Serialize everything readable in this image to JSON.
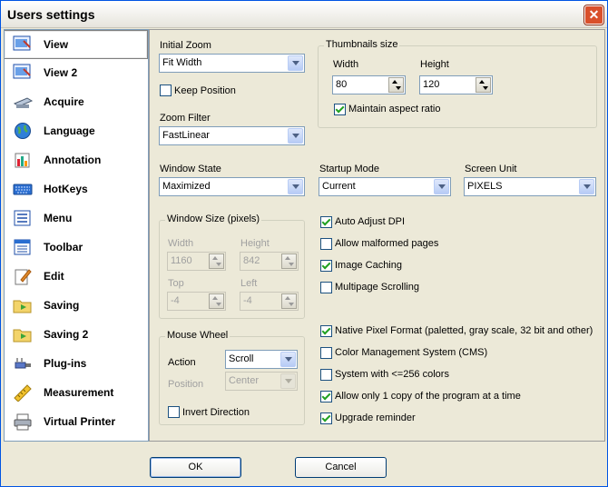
{
  "window": {
    "title": "Users settings"
  },
  "sidebar": {
    "items": [
      {
        "label": "View",
        "icon": "view-icon"
      },
      {
        "label": "View 2",
        "icon": "view2-icon"
      },
      {
        "label": "Acquire",
        "icon": "scanner-icon"
      },
      {
        "label": "Language",
        "icon": "globe-icon"
      },
      {
        "label": "Annotation",
        "icon": "annotation-icon"
      },
      {
        "label": "HotKeys",
        "icon": "keyboard-icon"
      },
      {
        "label": "Menu",
        "icon": "menu-icon"
      },
      {
        "label": "Toolbar",
        "icon": "toolbar-icon"
      },
      {
        "label": "Edit",
        "icon": "edit-icon"
      },
      {
        "label": "Saving",
        "icon": "save-folder-icon"
      },
      {
        "label": "Saving 2",
        "icon": "save-folder-icon"
      },
      {
        "label": "Plug-ins",
        "icon": "plugin-icon"
      },
      {
        "label": "Measurement",
        "icon": "ruler-icon"
      },
      {
        "label": "Virtual Printer",
        "icon": "printer-icon"
      }
    ],
    "selected": "View"
  },
  "view": {
    "initial_zoom": {
      "label": "Initial Zoom",
      "value": "Fit Width"
    },
    "keep_position": {
      "label": "Keep Position",
      "checked": false
    },
    "zoom_filter": {
      "label": "Zoom Filter",
      "value": "FastLinear"
    },
    "thumbnails": {
      "title": "Thumbnails size",
      "width_label": "Width",
      "width": "80",
      "height_label": "Height",
      "height": "120",
      "maintain": {
        "label": "Maintain aspect ratio",
        "checked": true
      }
    },
    "window_state": {
      "label": "Window State",
      "value": "Maximized"
    },
    "startup_mode": {
      "label": "Startup Mode",
      "value": "Current"
    },
    "screen_unit": {
      "label": "Screen Unit",
      "value": "PIXELS"
    },
    "window_size": {
      "title": "Window Size (pixels)",
      "width_label": "Width",
      "width": "1160",
      "height_label": "Height",
      "height": "842",
      "top_label": "Top",
      "top": "-4",
      "left_label": "Left",
      "left": "-4"
    },
    "mouse_wheel": {
      "title": "Mouse Wheel",
      "action_label": "Action",
      "action": "Scroll",
      "position_label": "Position",
      "position": "Center",
      "invert": {
        "label": "Invert Direction",
        "checked": false
      }
    },
    "options": [
      {
        "label": "Auto Adjust DPI",
        "checked": true
      },
      {
        "label": "Allow malformed pages",
        "checked": false
      },
      {
        "label": "Image Caching",
        "checked": true
      },
      {
        "label": "Multipage Scrolling",
        "checked": false
      }
    ],
    "options2": [
      {
        "label": "Native Pixel Format (paletted, gray scale, 32 bit and other)",
        "checked": true
      },
      {
        "label": "Color Management System (CMS)",
        "checked": false
      },
      {
        "label": "System with <=256 colors",
        "checked": false
      },
      {
        "label": "Allow only 1 copy of the program at a time",
        "checked": true
      },
      {
        "label": "Upgrade reminder",
        "checked": true
      }
    ]
  },
  "buttons": {
    "ok": "OK",
    "cancel": "Cancel"
  },
  "colors": {
    "title_bar_border": "#0054e3",
    "dialog_bg": "#ece9d8",
    "close_button": "#d9502b",
    "field_border": "#7f9db9"
  }
}
